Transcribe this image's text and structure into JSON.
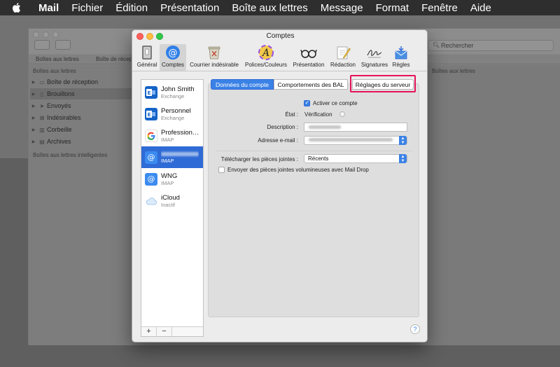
{
  "menubar": {
    "app": "Mail",
    "items": [
      "Fichier",
      "Édition",
      "Présentation",
      "Boîte aux lettres",
      "Message",
      "Format",
      "Fenêtre",
      "Aide"
    ]
  },
  "mail_window": {
    "favorites": [
      "Boîtes aux lettres",
      "Boîte de récep"
    ],
    "search_placeholder": "Rechercher",
    "sidebar_section": "Boîtes aux lettres",
    "sidebar_items": [
      {
        "label": "Boîte de réception",
        "icon": "inbox-icon"
      },
      {
        "label": "Brouillons",
        "icon": "draft-icon"
      },
      {
        "label": "Envoyés",
        "icon": "send-icon"
      },
      {
        "label": "Indésirables",
        "icon": "junk-icon"
      },
      {
        "label": "Corbeille",
        "icon": "trash-icon"
      },
      {
        "label": "Archives",
        "icon": "archive-icon"
      }
    ],
    "smart_section": "Boîtes aux lettres intelligentes",
    "right_header": "Boîtes aux lettres"
  },
  "dialog": {
    "title": "Comptes",
    "toolbar": [
      {
        "label": "Général",
        "icon": "general-icon"
      },
      {
        "label": "Comptes",
        "icon": "at-icon"
      },
      {
        "label": "Courrier indésirable",
        "icon": "junk-mail-icon"
      },
      {
        "label": "Polices/Couleurs",
        "icon": "fonts-icon"
      },
      {
        "label": "Présentation",
        "icon": "glasses-icon"
      },
      {
        "label": "Rédaction",
        "icon": "compose-icon"
      },
      {
        "label": "Signatures",
        "icon": "signature-icon"
      },
      {
        "label": "Règles",
        "icon": "rules-icon"
      }
    ],
    "accounts": [
      {
        "name": "John Smith",
        "type": "Exchange",
        "icon": "exchange-icon"
      },
      {
        "name": "Personnel",
        "type": "Exchange",
        "icon": "exchange-icon"
      },
      {
        "name": "Profession…",
        "type": "IMAP",
        "icon": "google-icon"
      },
      {
        "name": "",
        "type": "IMAP",
        "icon": "at-icon",
        "selected": true
      },
      {
        "name": "WNG",
        "type": "IMAP",
        "icon": "at-icon"
      },
      {
        "name": "iCloud",
        "type": "Inactif",
        "icon": "icloud-icon"
      }
    ],
    "add_label": "+",
    "remove_label": "−",
    "tabs": [
      "Données du compte",
      "Comportements des BAL",
      "Réglages du serveur"
    ],
    "form": {
      "enable_label": "Activer ce compte",
      "status_label": "État :",
      "status_value": "Vérification",
      "description_label": "Description :",
      "email_label": "Adresse e-mail :",
      "download_label": "Télécharger les pièces jointes :",
      "download_value": "Récents",
      "maildrop_label": "Envoyer des pièces jointes volumineuses avec Mail Drop"
    },
    "help_label": "?",
    "colors": {
      "accent": "#3b82e6",
      "highlight": "#e5135a",
      "selection": "#2f6bd6"
    }
  }
}
